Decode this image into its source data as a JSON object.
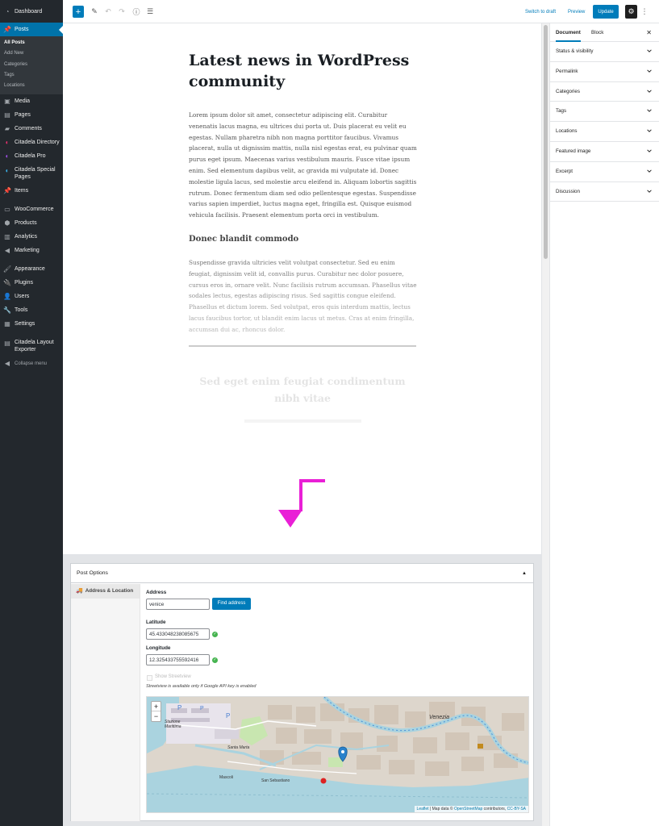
{
  "admin_menu": {
    "dashboard": "Dashboard",
    "posts": "Posts",
    "posts_sub": [
      "All Posts",
      "Add New",
      "Categories",
      "Tags",
      "Locations"
    ],
    "media": "Media",
    "pages": "Pages",
    "comments": "Comments",
    "citadela_directory": "Citadela Directory",
    "citadela_pro": "Citadela Pro",
    "citadela_special_pages": "Citadela Special Pages",
    "items": "Items",
    "woocommerce": "WooCommerce",
    "products": "Products",
    "analytics": "Analytics",
    "marketing": "Marketing",
    "appearance": "Appearance",
    "plugins": "Plugins",
    "users": "Users",
    "tools": "Tools",
    "settings": "Settings",
    "citadela_layout_exporter": "Citadela Layout Exporter",
    "collapse": "Collapse menu"
  },
  "toolbar": {
    "add_block": "+",
    "switch_to_draft": "Switch to draft",
    "preview": "Preview",
    "update": "Update",
    "more": "⋮"
  },
  "post": {
    "title": "Latest news in WordPress community",
    "paragraph_1": "Lorem ipsum dolor sit amet, consectetur adipiscing elit. Curabitur venenatis lacus magna, eu ultrices dui porta ut. Duis placerat eu velit eu egestas. Nullam pharetra nibh non magna porttitor faucibus. Vivamus placerat, nulla ut dignissim mattis, nulla nisl egestas erat, eu pulvinar quam purus eget ipsum. Maecenas varius vestibulum mauris. Fusce vitae ipsum enim. Sed elementum dapibus velit, ac gravida mi vulputate id. Donec molestie ligula lacus, sed molestie arcu eleifend in. Aliquam lobortis sagittis rutrum. Donec fermentum diam sed odio pellentesque egestas. Suspendisse varius sapien imperdiet, luctus magna eget, fringilla est. Quisque euismod vehicula facilisis. Praesent elementum porta orci in vestibulum.",
    "subheading": "Donec blandit commodo",
    "paragraph_2": "Suspendisse gravida ultricies velit volutpat consectetur. Sed eu enim feugiat, dignissim velit id, convallis purus. Curabitur nec dolor posuere, cursus eros in, ornare velit. Nunc facilisis rutrum accumsan. Phasellus vitae sodales lectus, egestas adipiscing risus. Sed sagittis congue eleifend. Phasellus et dictum lorem. Sed volutpat, eros quis interdum mattis, lectus lacus faucibus tortor, ut blandit enim lacus ut metus. Cras at enim fringilla, accumsan dui ac, rhoncus dolor.",
    "faded_heading": "Sed eget enim feugiat condimentum nibh vitae"
  },
  "doc_sidebar": {
    "tab_document": "Document",
    "tab_block": "Block",
    "close": "✕",
    "panels": [
      "Status & visibility",
      "Permalink",
      "Categories",
      "Tags",
      "Locations",
      "Featured image",
      "Excerpt",
      "Discussion"
    ]
  },
  "post_options": {
    "title": "Post Options",
    "toggle": "▲",
    "tab_address": "Address & Location",
    "address_label": "Address",
    "address_value": "venice",
    "find_address": "Find address",
    "latitude_label": "Latitude",
    "latitude_value": "45.433048238085675",
    "longitude_label": "Longitude",
    "longitude_value": "12.325433755592416",
    "show_streetview": "Show Streetview",
    "streetview_note": "Streetview is available only if Google API key is enabled"
  },
  "map": {
    "zoom_in": "+",
    "zoom_out": "−",
    "label_venezia": "Venezia",
    "label_stazione": "Stazione Marittima",
    "label_santa_marta": "Santa Marta",
    "label_mascoli": "Mascoli",
    "label_san_sebastiano": "San Sebastiano",
    "attribution_leaflet": "Leaflet",
    "attribution_mid": " | Map data © ",
    "attribution_osm": "OpenStreetMap",
    "attribution_contrib": " contributors, ",
    "attribution_license": "CC-BY-SA"
  },
  "colors": {
    "admin_bg": "#23282d",
    "accent": "#007cba",
    "arrow": "#e91fd6",
    "valid": "#46b450"
  }
}
